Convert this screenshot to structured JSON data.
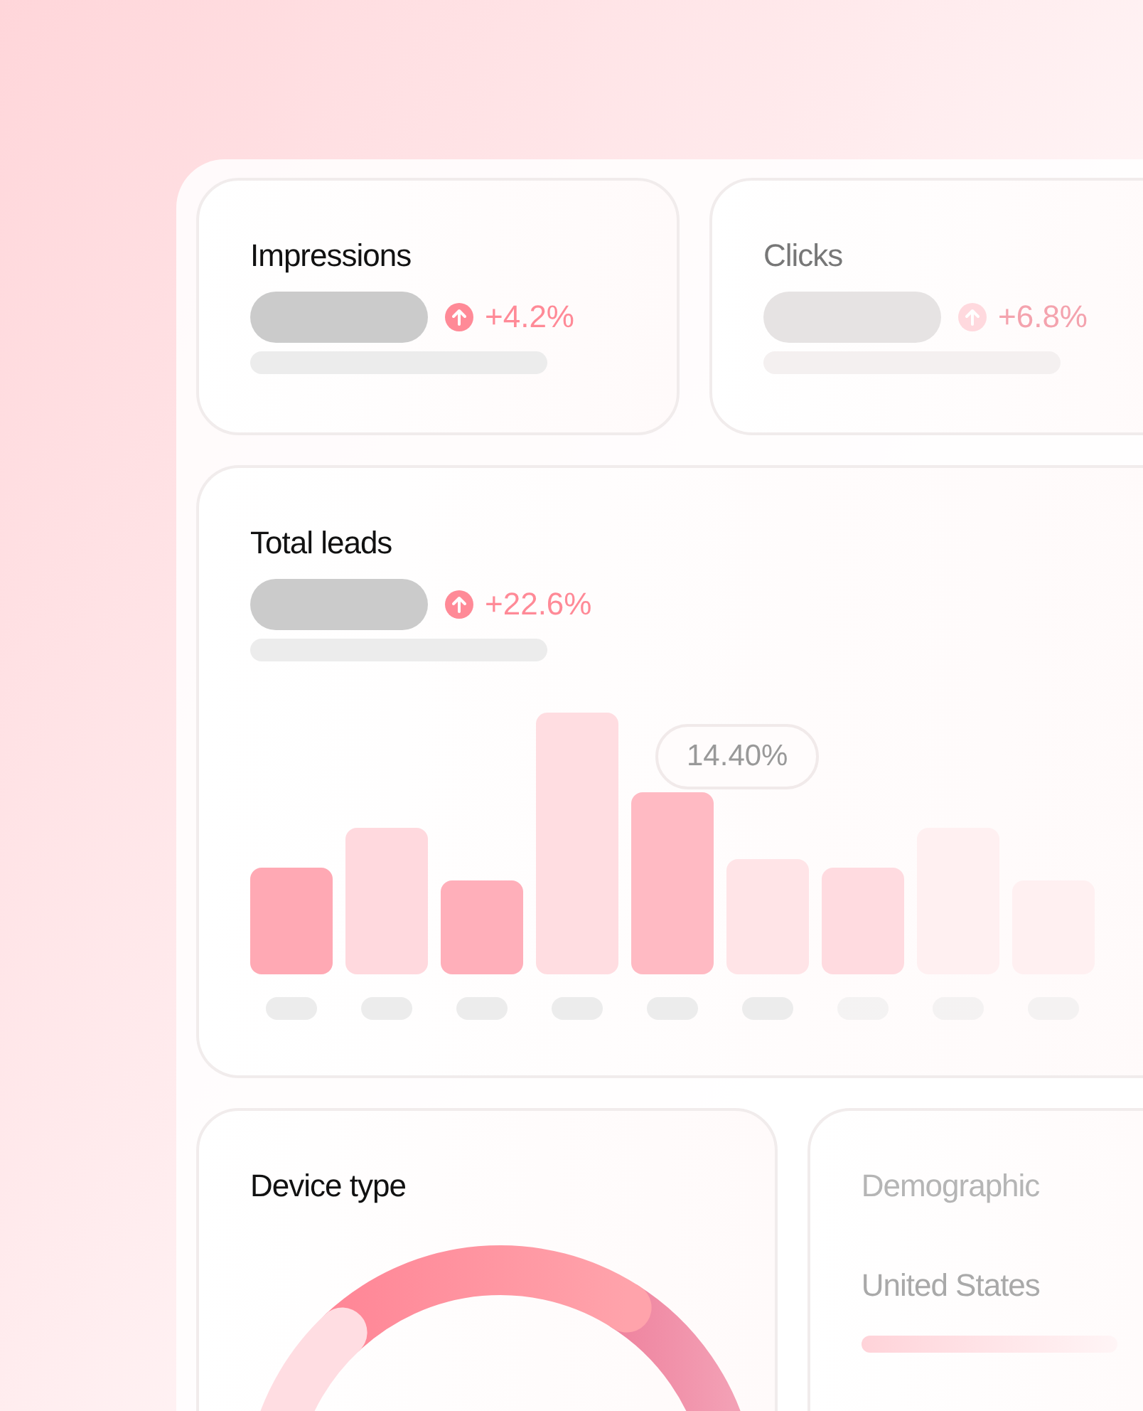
{
  "metrics": [
    {
      "title": "Impressions",
      "change": "+4.2%",
      "faded": false
    },
    {
      "title": "Clicks",
      "change": "+6.8%",
      "faded": true
    }
  ],
  "leads": {
    "title": "Total leads",
    "change": "+22.6%",
    "tooltip": "14.40%"
  },
  "device": {
    "title": "Device type"
  },
  "demographic": {
    "title": "Demographic",
    "country": "United States"
  }
}
